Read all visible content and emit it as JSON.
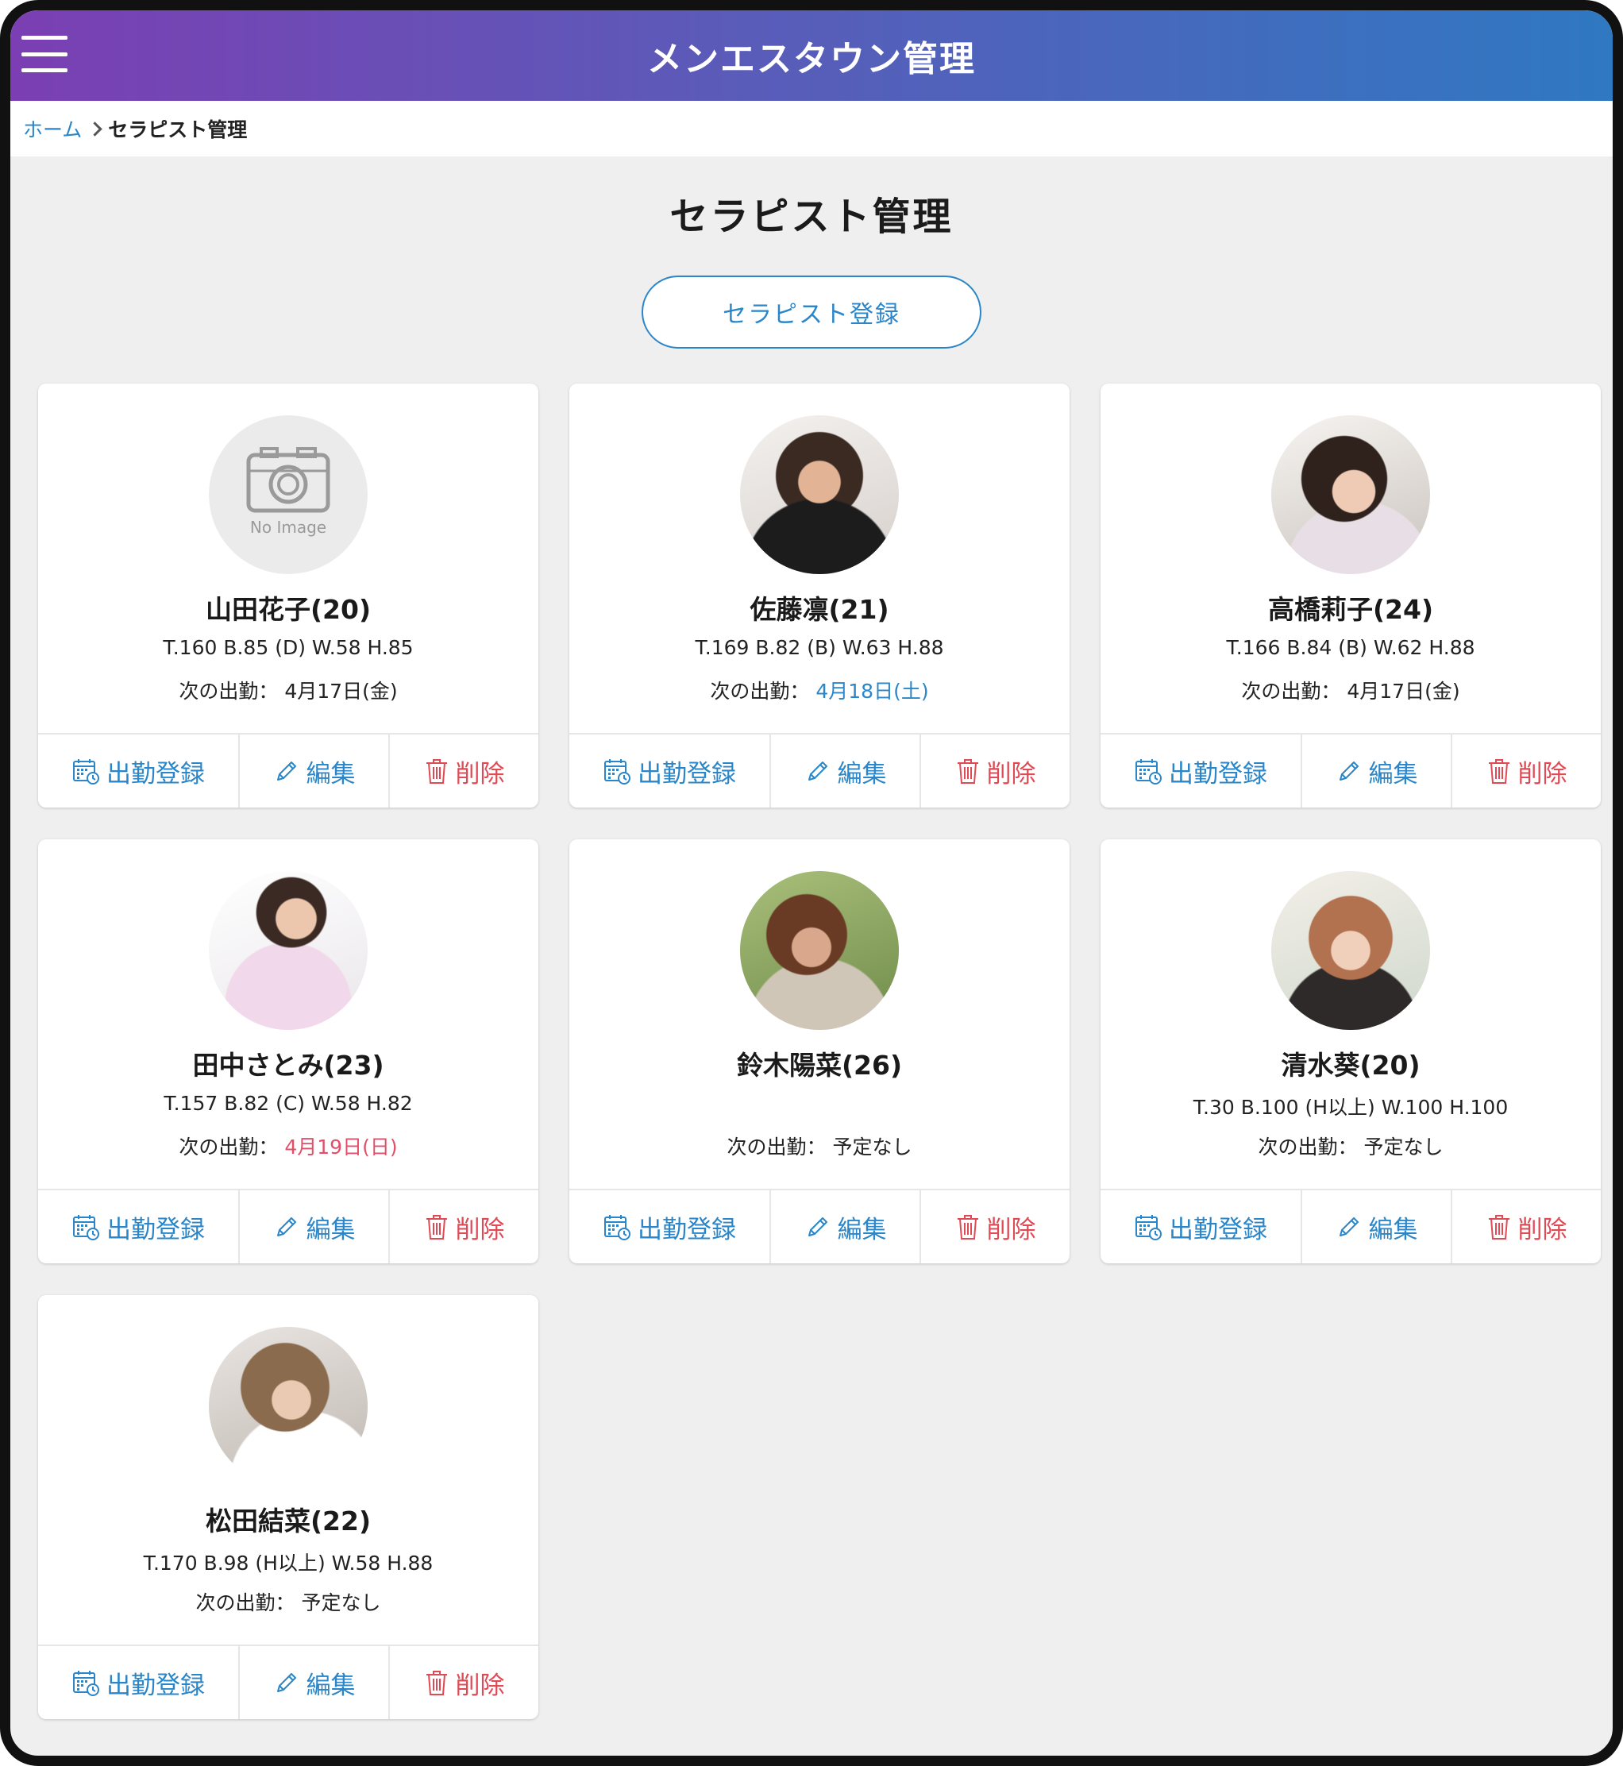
{
  "header": {
    "title": "メンエスタウン管理"
  },
  "breadcrumb": {
    "home": "ホーム",
    "current": "セラピスト管理"
  },
  "page": {
    "title": "セラピスト管理",
    "register_label": "セラピスト登録"
  },
  "card_actions": {
    "attendance": "出勤登録",
    "edit": "編集",
    "delete": "削除"
  },
  "next_label": "次の出勤：",
  "no_image_text": "No Image",
  "colors": {
    "header_start": "#7b3fb3",
    "header_end": "#2f78c2",
    "accent_blue": "#2a86c8",
    "delete_red": "#e04a55",
    "saturday_blue": "#2a86c8",
    "sunday_red": "#e0506a"
  },
  "therapists": [
    {
      "name": "山田花子(20)",
      "measurements": "T.160 B.85 (D) W.58 H.85",
      "next_value": "4月17日(金)",
      "next_style": "default",
      "image": "none"
    },
    {
      "name": "佐藤凛(21)",
      "measurements": "T.169 B.82 (B) W.63 H.88",
      "next_value": "4月18日(土)",
      "next_style": "blue",
      "image": "photo"
    },
    {
      "name": "高橋莉子(24)",
      "measurements": "T.166 B.84 (B) W.62 H.88",
      "next_value": "4月17日(金)",
      "next_style": "default",
      "image": "photo"
    },
    {
      "name": "田中さとみ(23)",
      "measurements": "T.157 B.82 (C) W.58 H.82",
      "next_value": "4月19日(日)",
      "next_style": "red",
      "image": "photo"
    },
    {
      "name": "鈴木陽菜(26)",
      "measurements": "",
      "next_value": "予定なし",
      "next_style": "default",
      "image": "photo"
    },
    {
      "name": "清水葵(20)",
      "measurements": "T.30 B.100 (H以上) W.100 H.100",
      "next_value": "予定なし",
      "next_style": "default",
      "image": "photo"
    },
    {
      "name": "松田結菜(22)",
      "measurements": "T.170 B.98 (H以上) W.58 H.88",
      "next_value": "予定なし",
      "next_style": "default",
      "image": "photo"
    }
  ]
}
